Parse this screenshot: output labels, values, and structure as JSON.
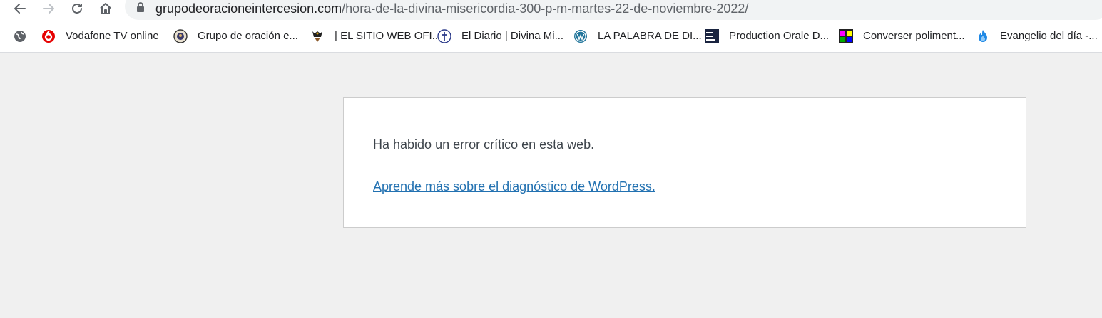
{
  "browser": {
    "url_host": "grupodeoracioneintercesion.com",
    "url_path": "/hora-de-la-divina-misericordia-300-p-m-martes-22-de-noviembre-2022/",
    "icons": [
      "back-icon",
      "forward-icon",
      "reload-icon",
      "home-icon",
      "lock-icon"
    ]
  },
  "bookmarks": {
    "items": [
      {
        "label": "",
        "icon": "globe-icon"
      },
      {
        "label": "Vodafone TV online",
        "icon": "vodafone-icon",
        "color": "#e60000"
      },
      {
        "label": "Grupo de oración e...",
        "icon": "group-seal-icon"
      },
      {
        "label": "| EL SITIO WEB OFI...",
        "icon": "crest-icon"
      },
      {
        "label": "El Diario | Divina Mi...",
        "icon": "cross-badge-icon"
      },
      {
        "label": "LA PALABRA DE DI...",
        "icon": "wordpress-icon",
        "color": "#21759b"
      },
      {
        "label": "Production Orale D...",
        "icon": "delf-dalf-icon",
        "logo_text": "DELF DALF SEVILLA"
      },
      {
        "label": "Converser poliment...",
        "icon": "color-grid-icon",
        "colors": [
          "#ff00ff",
          "#ffff00",
          "#00aa00",
          "#0000ff"
        ]
      },
      {
        "label": "Evangelio del día -...",
        "icon": "flame-icon",
        "color": "#1e88e5"
      }
    ]
  },
  "error_page": {
    "message": "Ha habido un error crítico en esta web.",
    "link_text": "Aprende más sobre el diagnóstico de WordPress.",
    "link_color": "#2271b1"
  }
}
